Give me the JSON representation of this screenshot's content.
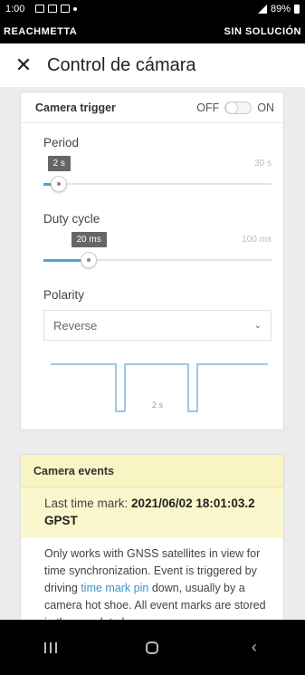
{
  "status_bar": {
    "time": "1:00",
    "battery": "89%"
  },
  "app_bar": {
    "left_text": "REACHMETTA",
    "right_text": "SIN SOLUCIÓN"
  },
  "header": {
    "title": "Control de cámara"
  },
  "camera_trigger": {
    "title": "Camera trigger",
    "toggle_off": "OFF",
    "toggle_on": "ON",
    "toggle_state": "off",
    "period": {
      "label": "Period",
      "value": "2 s",
      "max": "30 s",
      "fraction": 0.067
    },
    "duty_cycle": {
      "label": "Duty cycle",
      "value": "20 ms",
      "max": "100 ms",
      "fraction": 0.2
    },
    "polarity": {
      "label": "Polarity",
      "selected": "Reverse"
    },
    "waveform_label": "2 s"
  },
  "camera_events": {
    "title": "Camera events",
    "last_mark_label": "Last time mark:",
    "last_mark_value": "2021/06/02 18:01:03.2 GPST",
    "description_1": "Only works with GNSS satellites in view for time synchronization. Event is triggered by driving",
    "description_link": "time mark pin",
    "description_2": "down, usually by a camera hot shoe. All event marks are stored in the raw data log."
  },
  "colors": {
    "accent": "#4da3d9",
    "highlight": "#f8f4c4"
  }
}
